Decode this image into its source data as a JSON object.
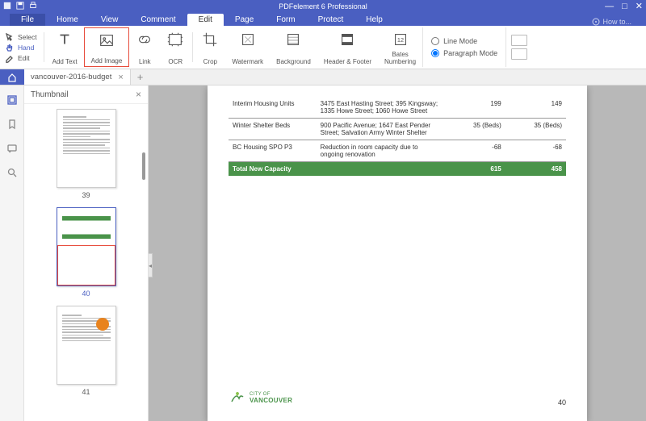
{
  "app": {
    "title": "PDFelement 6 Professional",
    "how_to": "How to..."
  },
  "menus": {
    "file": "File",
    "home": "Home",
    "view": "View",
    "comment": "Comment",
    "edit": "Edit",
    "page": "Page",
    "form": "Form",
    "protect": "Protect",
    "help": "Help"
  },
  "ribbon": {
    "select": "Select",
    "hand": "Hand",
    "edit": "Edit",
    "add_text": "Add Text",
    "add_image": "Add Image",
    "link": "Link",
    "ocr": "OCR",
    "crop": "Crop",
    "watermark": "Watermark",
    "background": "Background",
    "header_footer": "Header & Footer",
    "bates": "Bates\nNumbering",
    "line_mode": "Line Mode",
    "paragraph_mode": "Paragraph Mode"
  },
  "tabs": {
    "doc_name": "vancouver-2016-budget"
  },
  "thumbnail": {
    "title": "Thumbnail",
    "pages": [
      {
        "num": "39"
      },
      {
        "num": "40",
        "selected": true
      },
      {
        "num": "41"
      }
    ]
  },
  "document": {
    "rows": [
      {
        "c1": "Interim Housing Units",
        "c2": "3475 East Hasting Street; 395 Kingsway; 1335 Howe Street; 1060 Howe Street",
        "c3": "199",
        "c4": "149"
      },
      {
        "c1": "Winter Shelter Beds",
        "c2": "900 Pacific Avenue; 1647 East Pender Street; Salvation Army Winter Shelter",
        "c3": "35 (Beds)",
        "c4": "35 (Beds)"
      },
      {
        "c1": "BC Housing SPO P3",
        "c2": "Reduction in room capacity due to ongoing renovation",
        "c3": "-68",
        "c4": "-68"
      }
    ],
    "total": {
      "label": "Total New Capacity",
      "c3": "615",
      "c4": "458"
    },
    "footer_logo_top": "CITY OF",
    "footer_logo_bottom": "VANCOUVER",
    "page_num": "40"
  }
}
